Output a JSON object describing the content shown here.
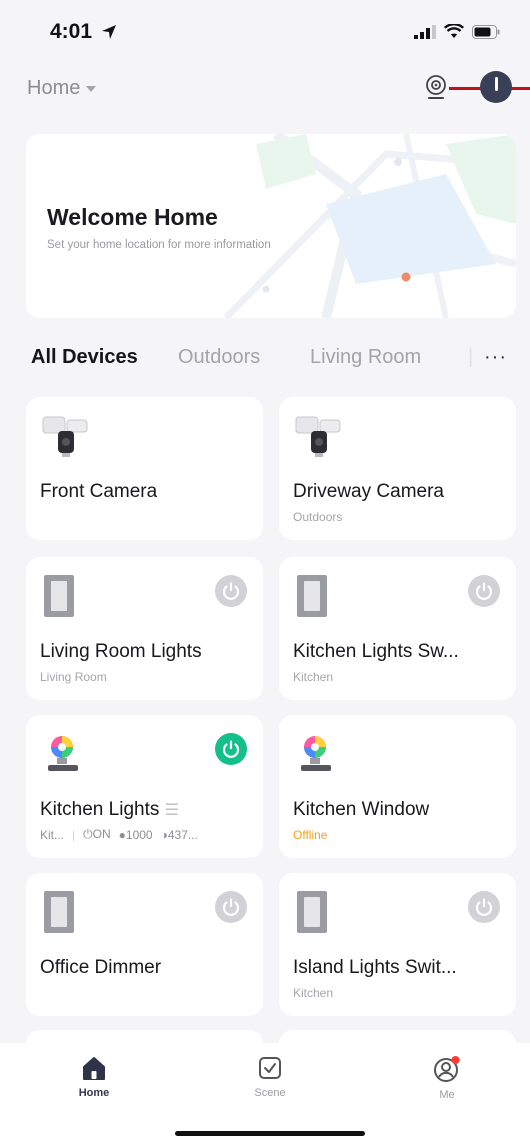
{
  "status_bar": {
    "time": "4:01"
  },
  "header": {
    "home_label": "Home"
  },
  "welcome": {
    "title": "Welcome Home",
    "subtitle": "Set your home location for more information"
  },
  "tabs": [
    {
      "label": "All Devices",
      "active": true
    },
    {
      "label": "Outdoors",
      "active": false
    },
    {
      "label": "Living Room",
      "active": false
    }
  ],
  "more_label": "···",
  "devices": [
    {
      "name": "Front Camera",
      "room": "",
      "type": "camera",
      "power": null
    },
    {
      "name": "Driveway Camera",
      "room": "Outdoors",
      "type": "camera",
      "power": null
    },
    {
      "name": "Living Room Lights",
      "room": "Living Room",
      "type": "switch",
      "power": "off"
    },
    {
      "name": "Kitchen Lights Sw...",
      "room": "Kitchen",
      "type": "switch",
      "power": "off"
    },
    {
      "name": "Kitchen Lights",
      "room": "",
      "type": "bulb",
      "power": "on",
      "status": {
        "room_short": "Kit...",
        "state": "ON",
        "brightness": "1000",
        "temperature": "437..."
      }
    },
    {
      "name": "Kitchen Window",
      "room": "Offline",
      "type": "bulb",
      "power": null,
      "offline": true
    },
    {
      "name": "Office Dimmer",
      "room": "",
      "type": "switch",
      "power": "off"
    },
    {
      "name": "Island Lights Swit...",
      "room": "Kitchen",
      "type": "switch",
      "power": "off"
    }
  ],
  "nav": [
    {
      "label": "Home",
      "active": true,
      "icon": "home-icon"
    },
    {
      "label": "Scene",
      "active": false,
      "icon": "scene-icon"
    },
    {
      "label": "Me",
      "active": false,
      "icon": "profile-icon"
    }
  ],
  "colors": {
    "accent": "#3a3f58",
    "power_on": "#13c08a",
    "power_off": "#d2d2d6",
    "offline": "#f2a31b",
    "annotation": "#c0101a"
  }
}
